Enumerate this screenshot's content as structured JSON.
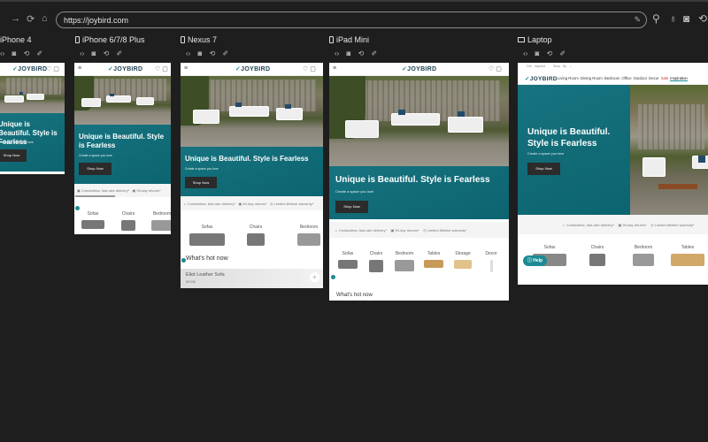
{
  "browser": {
    "url": "https://joybird.com",
    "icons": [
      "back-icon",
      "forward-icon",
      "reload-icon",
      "home-icon",
      "pen-icon",
      "pin-icon",
      "bottle-icon",
      "screenshot-icon",
      "rotate-icon"
    ]
  },
  "devices": [
    {
      "name": "iPhone 4"
    },
    {
      "name": "iPhone 6/7/8 Plus"
    },
    {
      "name": "Nexus 7"
    },
    {
      "name": "iPad Mini"
    },
    {
      "name": "Laptop"
    }
  ],
  "device_toolbar": [
    "code-icon",
    "screenshot-icon",
    "rotate-icon",
    "eyedropper-icon"
  ],
  "site": {
    "logo": "JOYBIRD",
    "hero_title": "Unique is Beautiful. Style is Fearless",
    "hero_sub": "Create a space you love",
    "shop_now": "Shop Now",
    "features": [
      "Contactless, fast-rate delivery*",
      "90-day returns*",
      "Limited lifetime warranty*"
    ],
    "categories": [
      "Sofas",
      "Chairs",
      "Bedroom",
      "Tables",
      "Storage",
      "Decor"
    ],
    "whats_hot": "What's hot now",
    "product": {
      "name": "Eliot Leather Sofa",
      "price": "$2036"
    },
    "help": "Help",
    "laptop_topbar": [
      "Get Inspired",
      "Shop By ⌄"
    ],
    "laptop_nav": [
      "Living Room",
      "Dining Room",
      "Bedroom",
      "Office",
      "Outdoor",
      "Decor",
      "Sale",
      "Inspiration"
    ]
  },
  "colors": {
    "teal": "#0f6c78",
    "accent": "#1b8a94",
    "sale": "#d04040"
  }
}
